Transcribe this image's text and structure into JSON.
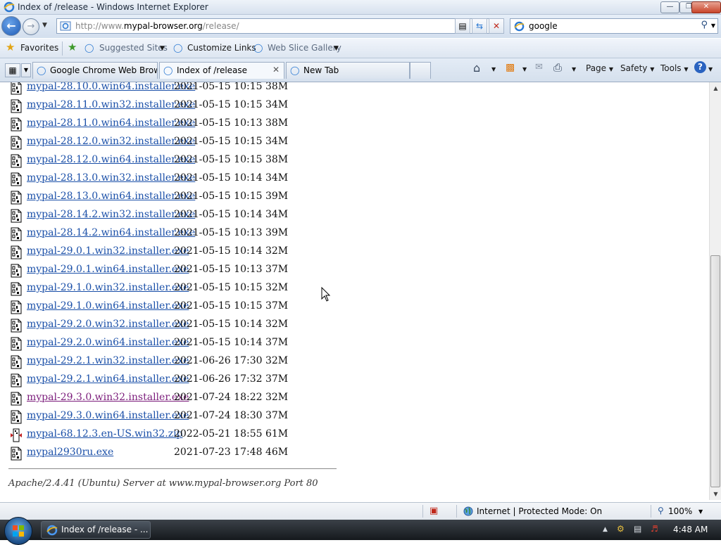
{
  "window": {
    "title": "Index of /release - Windows Internet Explorer"
  },
  "address": {
    "url_prefix": "http://www.",
    "url_domain": "mypal-browser.org",
    "url_path": "/release/"
  },
  "search": {
    "query": "google"
  },
  "favorites_bar": {
    "favorites_label": "Favorites",
    "items": [
      "Suggested Sites",
      "Customize Links",
      "Web Slice Gallery"
    ]
  },
  "tabs": [
    {
      "label": "Google Chrome Web Brow...",
      "active": false
    },
    {
      "label": "Index of /release",
      "active": true
    },
    {
      "label": "New Tab",
      "active": false
    }
  ],
  "command_bar": {
    "page": "Page",
    "safety": "Safety",
    "tools": "Tools"
  },
  "listing": [
    {
      "name": "mypal-28.10.0.win64.installer.exe",
      "modified": "2021-05-15 10:15",
      "size": "38M",
      "icon": "exe"
    },
    {
      "name": "mypal-28.11.0.win32.installer.exe",
      "modified": "2021-05-15 10:15",
      "size": "34M",
      "icon": "exe"
    },
    {
      "name": "mypal-28.11.0.win64.installer.exe",
      "modified": "2021-05-15 10:13",
      "size": "38M",
      "icon": "exe"
    },
    {
      "name": "mypal-28.12.0.win32.installer.exe",
      "modified": "2021-05-15 10:15",
      "size": "34M",
      "icon": "exe"
    },
    {
      "name": "mypal-28.12.0.win64.installer.exe",
      "modified": "2021-05-15 10:15",
      "size": "38M",
      "icon": "exe"
    },
    {
      "name": "mypal-28.13.0.win32.installer.exe",
      "modified": "2021-05-15 10:14",
      "size": "34M",
      "icon": "exe"
    },
    {
      "name": "mypal-28.13.0.win64.installer.exe",
      "modified": "2021-05-15 10:15",
      "size": "39M",
      "icon": "exe"
    },
    {
      "name": "mypal-28.14.2.win32.installer.exe",
      "modified": "2021-05-15 10:14",
      "size": "34M",
      "icon": "exe"
    },
    {
      "name": "mypal-28.14.2.win64.installer.exe",
      "modified": "2021-05-15 10:13",
      "size": "39M",
      "icon": "exe"
    },
    {
      "name": "mypal-29.0.1.win32.installer.exe",
      "modified": "2021-05-15 10:14",
      "size": "32M",
      "icon": "exe"
    },
    {
      "name": "mypal-29.0.1.win64.installer.exe",
      "modified": "2021-05-15 10:13",
      "size": "37M",
      "icon": "exe"
    },
    {
      "name": "mypal-29.1.0.win32.installer.exe",
      "modified": "2021-05-15 10:15",
      "size": "32M",
      "icon": "exe"
    },
    {
      "name": "mypal-29.1.0.win64.installer.exe",
      "modified": "2021-05-15 10:15",
      "size": "37M",
      "icon": "exe"
    },
    {
      "name": "mypal-29.2.0.win32.installer.exe",
      "modified": "2021-05-15 10:14",
      "size": "32M",
      "icon": "exe"
    },
    {
      "name": "mypal-29.2.0.win64.installer.exe",
      "modified": "2021-05-15 10:14",
      "size": "37M",
      "icon": "exe"
    },
    {
      "name": "mypal-29.2.1.win32.installer.exe",
      "modified": "2021-06-26 17:30",
      "size": "32M",
      "icon": "exe"
    },
    {
      "name": "mypal-29.2.1.win64.installer.exe",
      "modified": "2021-06-26 17:32",
      "size": "37M",
      "icon": "exe"
    },
    {
      "name": "mypal-29.3.0.win32.installer.exe",
      "modified": "2021-07-24 18:22",
      "size": "32M",
      "icon": "exe",
      "visited": true
    },
    {
      "name": "mypal-29.3.0.win64.installer.exe",
      "modified": "2021-07-24 18:30",
      "size": "37M",
      "icon": "exe"
    },
    {
      "name": "mypal-68.12.3.en-US.win32.zip",
      "modified": "2022-05-21 18:55",
      "size": "61M",
      "icon": "zip"
    },
    {
      "name": "mypal2930ru.exe",
      "modified": "2021-07-23 17:48",
      "size": "46M",
      "icon": "exe"
    }
  ],
  "server_footer": "Apache/2.4.41 (Ubuntu) Server at www.mypal-browser.org Port 80",
  "status_bar": {
    "zone": "Internet | Protected Mode: On",
    "zoom": "100%"
  },
  "taskbar": {
    "window_button": "Index of /release - ...",
    "clock": "4:48 AM"
  }
}
